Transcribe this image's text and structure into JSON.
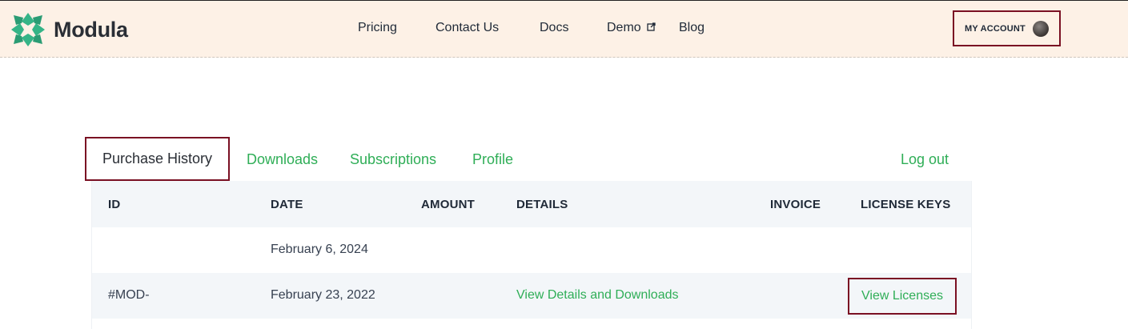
{
  "brand": {
    "name": "Modula",
    "colors": {
      "accent": "#2fae57",
      "highlight": "#7a1023",
      "header_bg": "#fdf1e6"
    }
  },
  "nav": {
    "items": [
      {
        "label": "Pricing"
      },
      {
        "label": "Contact Us"
      },
      {
        "label": "Docs"
      },
      {
        "label": "Demo",
        "icon": "external-link-icon"
      },
      {
        "label": "Blog"
      }
    ],
    "account_label": "MY ACCOUNT"
  },
  "tabs": {
    "active": "Purchase History",
    "items": [
      "Downloads",
      "Subscriptions",
      "Profile"
    ],
    "logout": "Log out"
  },
  "table": {
    "headers": [
      "ID",
      "DATE",
      "AMOUNT",
      "DETAILS",
      "INVOICE",
      "LICENSE KEYS"
    ],
    "rows": [
      {
        "id": "",
        "date": "February 6, 2024",
        "amount": "",
        "details": "",
        "invoice": "",
        "license": ""
      },
      {
        "id": "#MOD-",
        "date": "February 23, 2022",
        "amount": "",
        "details": "View Details and Downloads",
        "invoice": "",
        "license": "View Licenses"
      }
    ]
  }
}
